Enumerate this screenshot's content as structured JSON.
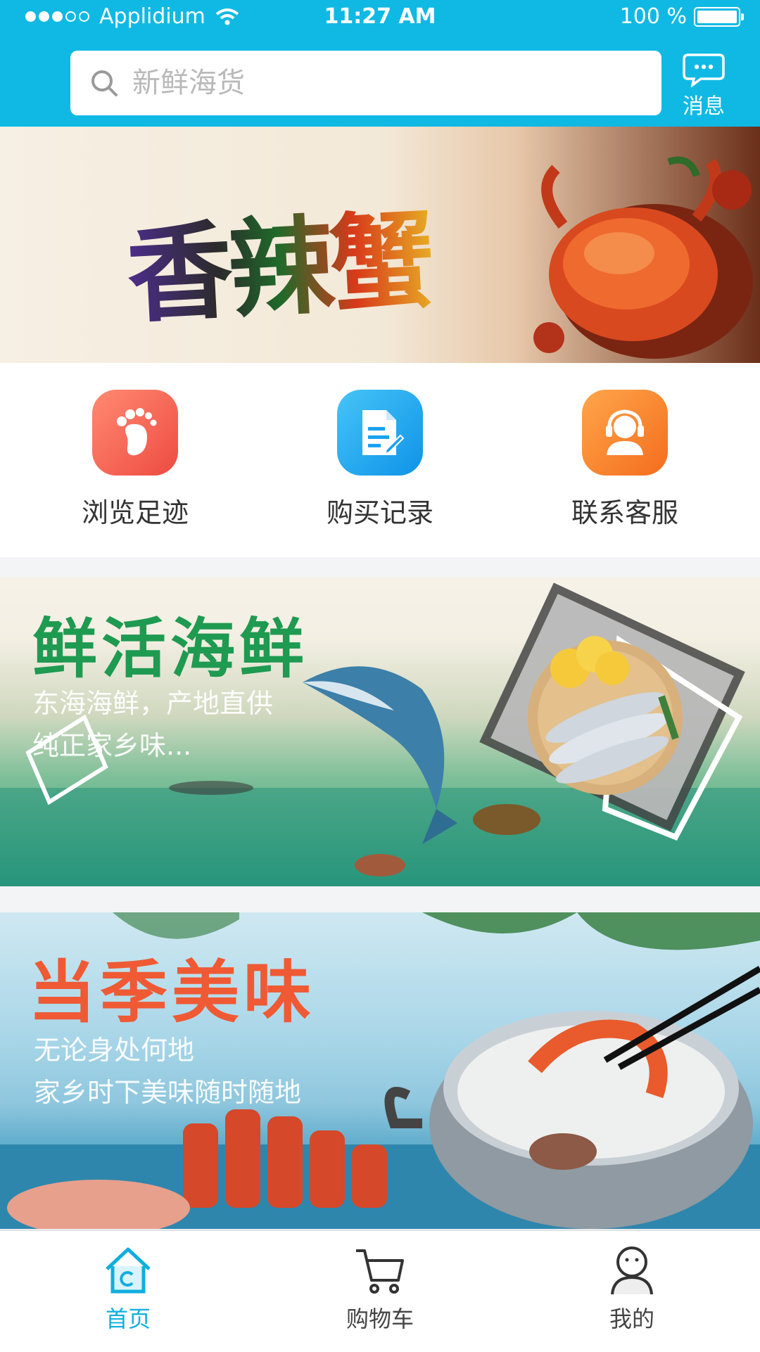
{
  "status_bar": {
    "carrier": "Applidium",
    "time": "11:27 AM",
    "battery": "100 %"
  },
  "header": {
    "search_placeholder": "新鲜海货",
    "message_label": "消息"
  },
  "banner": {
    "title": "香辣蟹",
    "page_count": 5,
    "active_page": 1
  },
  "shortcuts": [
    {
      "label": "浏览足迹",
      "icon": "footprint-icon"
    },
    {
      "label": "购买记录",
      "icon": "document-icon"
    },
    {
      "label": "联系客服",
      "icon": "customer-service-icon"
    }
  ],
  "promos": [
    {
      "title": "鲜活海鲜",
      "lines": [
        "东海海鲜，产地直供",
        "纯正家乡味..."
      ]
    },
    {
      "title": "当季美味",
      "lines": [
        "无论身处何地",
        "家乡时下美味随时随地"
      ]
    }
  ],
  "tabbar": {
    "items": [
      {
        "label": "首页",
        "icon": "home-icon",
        "active": true
      },
      {
        "label": "购物车",
        "icon": "cart-icon",
        "active": false
      },
      {
        "label": "我的",
        "icon": "profile-icon",
        "active": false
      }
    ]
  },
  "colors": {
    "accent": "#0fb9e4",
    "footprint": "#f2584d",
    "document": "#1aa7ee",
    "service": "#f6822b"
  }
}
